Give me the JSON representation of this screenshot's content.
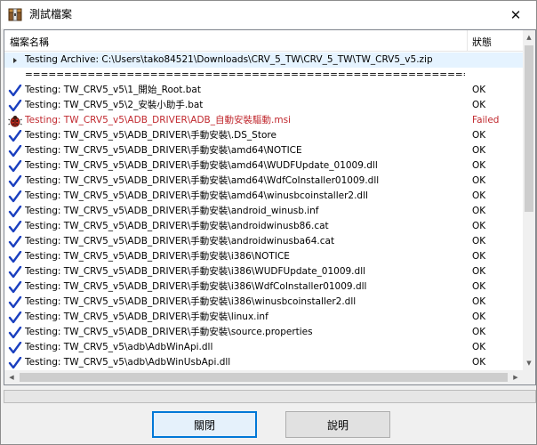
{
  "window": {
    "title": "測試檔案",
    "close_glyph": "✕",
    "icon": "archive-app-icon"
  },
  "list": {
    "columns": {
      "name": "檔案名稱",
      "status": "狀態"
    },
    "rows": [
      {
        "kind": "archive",
        "name": "Testing Archive: C:\\Users\\tako84521\\Downloads\\CRV_5_TW\\CRV_5_TW\\TW_CRV5_v5.zip",
        "status": ""
      },
      {
        "kind": "separator",
        "name": "==============================================================",
        "status": ""
      },
      {
        "kind": "ok",
        "name": "Testing: TW_CRV5_v5\\1_開始_Root.bat",
        "status": "OK"
      },
      {
        "kind": "ok",
        "name": "Testing: TW_CRV5_v5\\2_安裝小助手.bat",
        "status": "OK"
      },
      {
        "kind": "fail",
        "name": "Testing: TW_CRV5_v5\\ADB_DRIVER\\ADB_自動安裝驅動.msi",
        "status": "Failed"
      },
      {
        "kind": "ok",
        "name": "Testing: TW_CRV5_v5\\ADB_DRIVER\\手動安裝\\.DS_Store",
        "status": "OK"
      },
      {
        "kind": "ok",
        "name": "Testing: TW_CRV5_v5\\ADB_DRIVER\\手動安裝\\amd64\\NOTICE",
        "status": "OK"
      },
      {
        "kind": "ok",
        "name": "Testing: TW_CRV5_v5\\ADB_DRIVER\\手動安裝\\amd64\\WUDFUpdate_01009.dll",
        "status": "OK"
      },
      {
        "kind": "ok",
        "name": "Testing: TW_CRV5_v5\\ADB_DRIVER\\手動安裝\\amd64\\WdfCoInstaller01009.dll",
        "status": "OK"
      },
      {
        "kind": "ok",
        "name": "Testing: TW_CRV5_v5\\ADB_DRIVER\\手動安裝\\amd64\\winusbcoinstaller2.dll",
        "status": "OK"
      },
      {
        "kind": "ok",
        "name": "Testing: TW_CRV5_v5\\ADB_DRIVER\\手動安裝\\android_winusb.inf",
        "status": "OK"
      },
      {
        "kind": "ok",
        "name": "Testing: TW_CRV5_v5\\ADB_DRIVER\\手動安裝\\androidwinusb86.cat",
        "status": "OK"
      },
      {
        "kind": "ok",
        "name": "Testing: TW_CRV5_v5\\ADB_DRIVER\\手動安裝\\androidwinusba64.cat",
        "status": "OK"
      },
      {
        "kind": "ok",
        "name": "Testing: TW_CRV5_v5\\ADB_DRIVER\\手動安裝\\i386\\NOTICE",
        "status": "OK"
      },
      {
        "kind": "ok",
        "name": "Testing: TW_CRV5_v5\\ADB_DRIVER\\手動安裝\\i386\\WUDFUpdate_01009.dll",
        "status": "OK"
      },
      {
        "kind": "ok",
        "name": "Testing: TW_CRV5_v5\\ADB_DRIVER\\手動安裝\\i386\\WdfCoInstaller01009.dll",
        "status": "OK"
      },
      {
        "kind": "ok",
        "name": "Testing: TW_CRV5_v5\\ADB_DRIVER\\手動安裝\\i386\\winusbcoinstaller2.dll",
        "status": "OK"
      },
      {
        "kind": "ok",
        "name": "Testing: TW_CRV5_v5\\ADB_DRIVER\\手動安裝\\linux.inf",
        "status": "OK"
      },
      {
        "kind": "ok",
        "name": "Testing: TW_CRV5_v5\\ADB_DRIVER\\手動安裝\\source.properties",
        "status": "OK"
      },
      {
        "kind": "ok",
        "name": "Testing: TW_CRV5_v5\\adb\\AdbWinApi.dll",
        "status": "OK"
      },
      {
        "kind": "ok",
        "name": "Testing: TW_CRV5_v5\\adb\\AdbWinUsbApi.dll",
        "status": "OK"
      }
    ]
  },
  "buttons": {
    "close": "關閉",
    "help": "說明"
  },
  "colors": {
    "ok_check": "#1a3fbf",
    "failed_text": "#c0282e",
    "selected_row": "#e5f3ff",
    "default_button_border": "#0078d7"
  }
}
